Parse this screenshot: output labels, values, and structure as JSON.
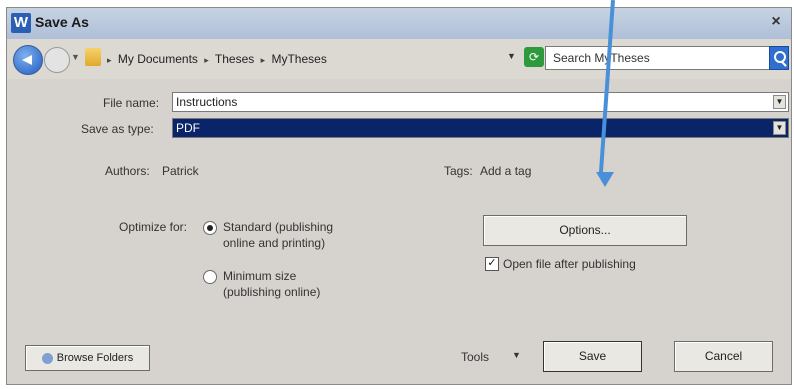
{
  "window": {
    "title": "Save As",
    "app_icon": "W",
    "close": "×"
  },
  "nav": {
    "breadcrumb": [
      "My Documents",
      "Theses",
      "MyTheses"
    ],
    "search_placeholder": "Search MyTheses"
  },
  "form": {
    "file_name_label": "File name:",
    "file_name_value": "Instructions",
    "save_type_label": "Save as type:",
    "save_type_value": "PDF",
    "authors_label": "Authors:",
    "authors_value": "Patrick",
    "tags_label": "Tags:",
    "tags_value": "Add a tag"
  },
  "optimize": {
    "label": "Optimize for:",
    "standard_line1": "Standard (publishing",
    "standard_line2": "online and printing)",
    "minimum_line1": "Minimum size",
    "minimum_line2": "(publishing online)",
    "selected": "standard"
  },
  "options_button": "Options...",
  "open_after": {
    "label": "Open file after publishing",
    "checked": true
  },
  "footer": {
    "browse_folders": "Browse Folders",
    "tools": "Tools",
    "save": "Save",
    "cancel": "Cancel"
  },
  "annotation": {
    "color": "#4a90d9"
  }
}
